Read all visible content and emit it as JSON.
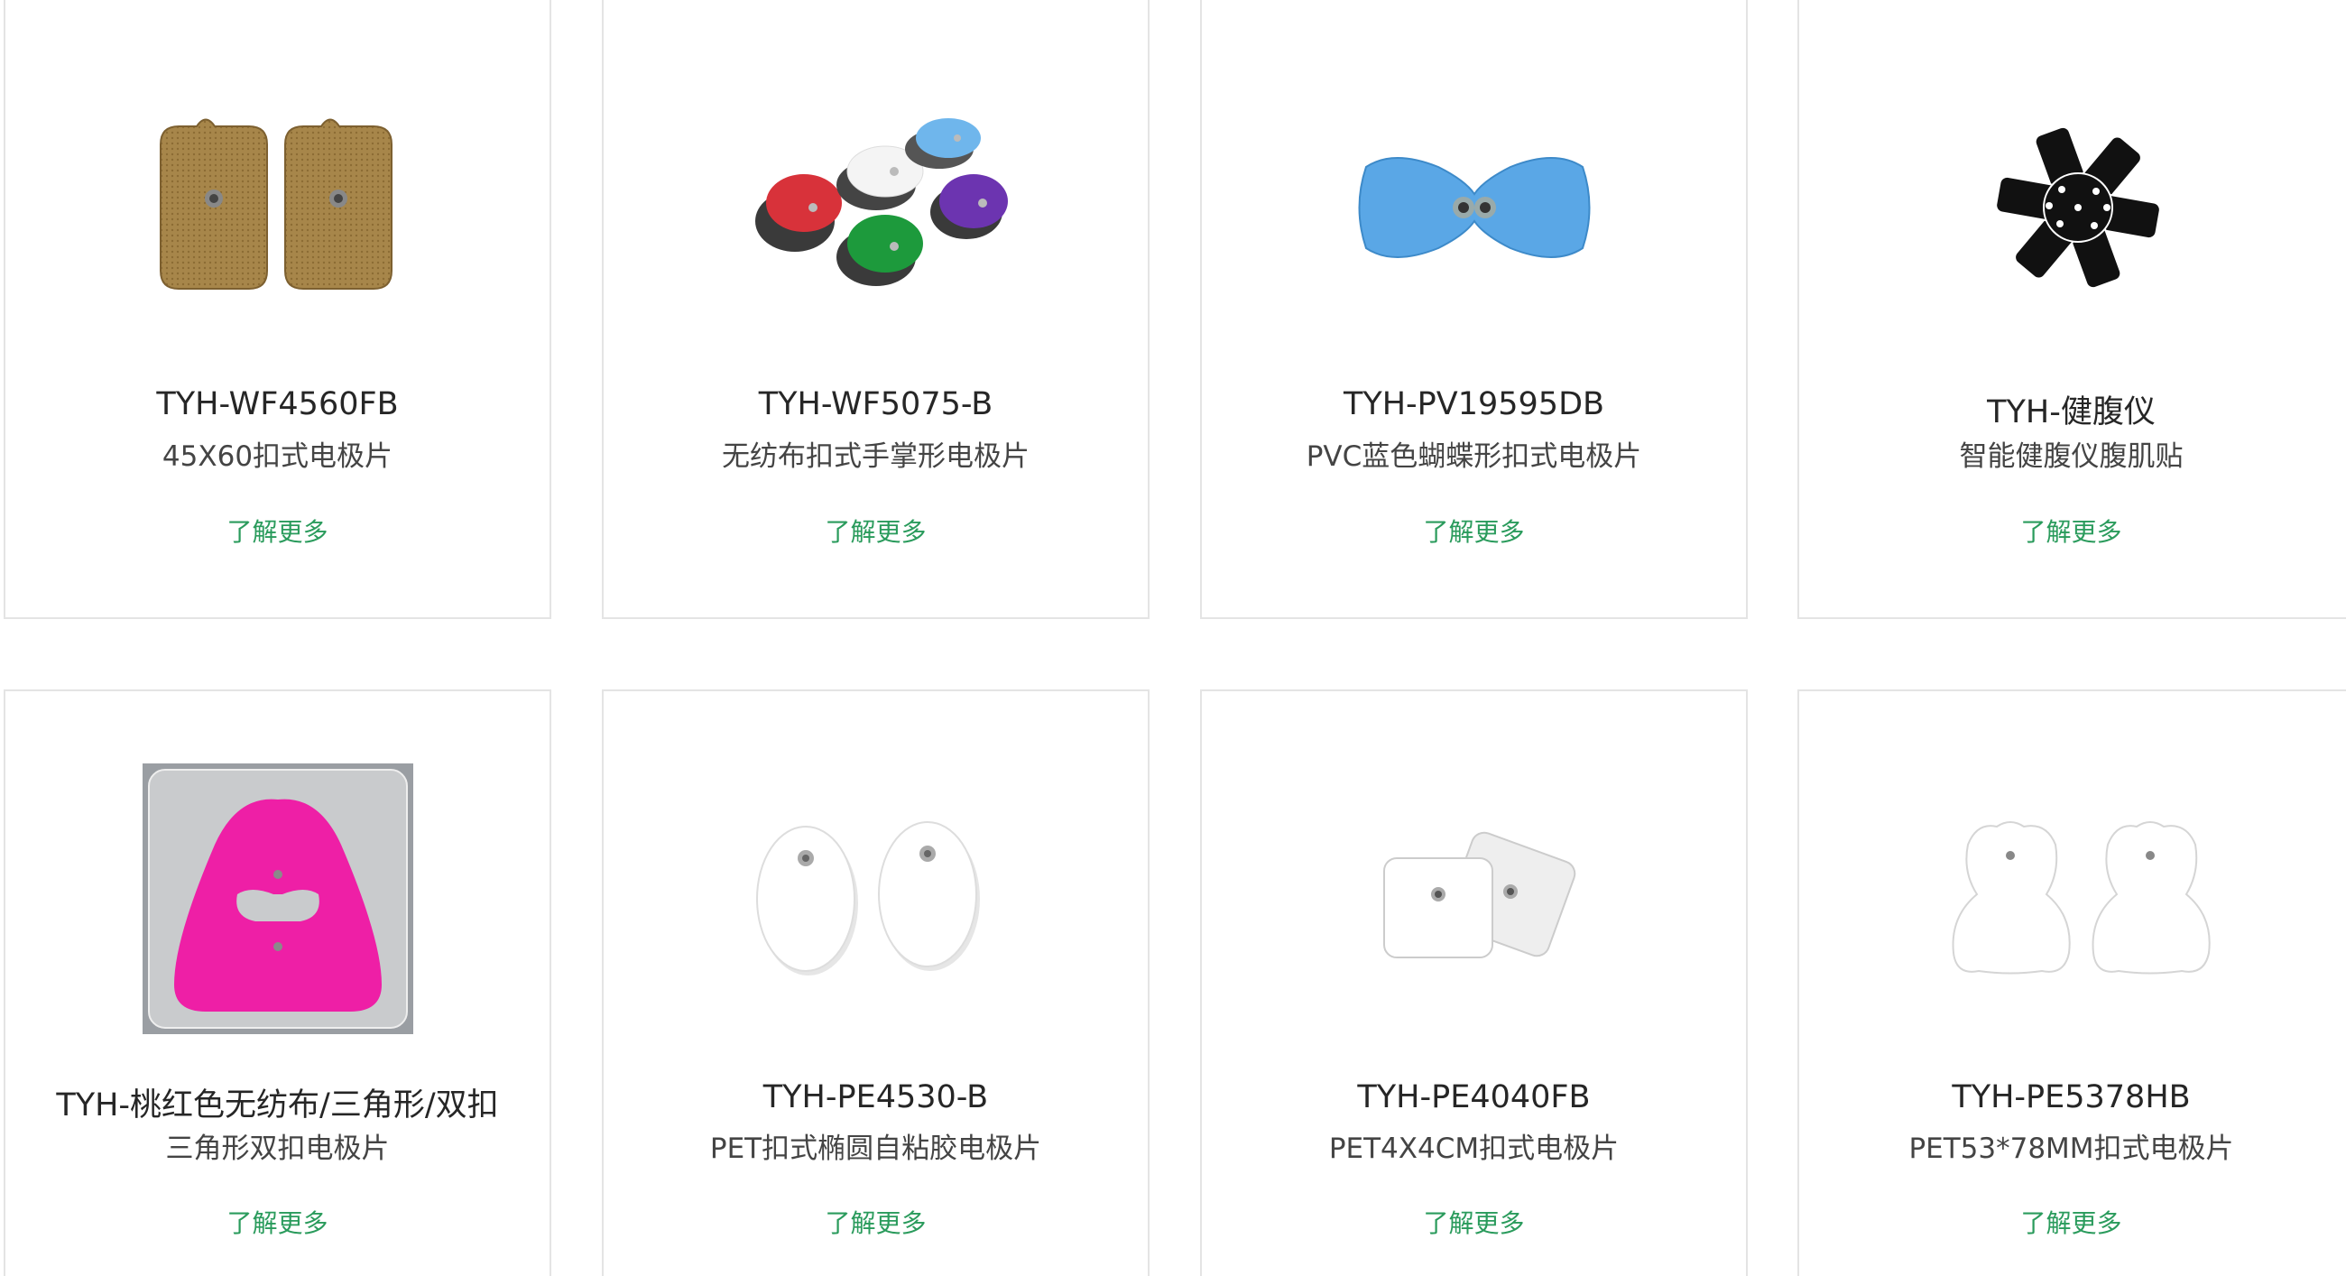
{
  "products": [
    {
      "name": "TYH-WF4560FB",
      "desc": "45X60扣式电极片",
      "link": "了解更多"
    },
    {
      "name": "TYH-WF5075-B",
      "desc": "无纺布扣式手掌形电极片",
      "link": "了解更多"
    },
    {
      "name": "TYH-PV19595DB",
      "desc": "PVC蓝色蝴蝶形扣式电极片",
      "link": "了解更多"
    },
    {
      "name": "TYH-健腹仪",
      "desc": "智能健腹仪腹肌贴",
      "link": "了解更多"
    },
    {
      "name": "TYH-桃红色无纺布/三角形/双扣",
      "desc": "三角形双扣电极片",
      "link": "了解更多"
    },
    {
      "name": "TYH-PE4530-B",
      "desc": "PET扣式椭圆自粘胶电极片",
      "link": "了解更多"
    },
    {
      "name": "TYH-PE4040FB",
      "desc": "PET4X4CM扣式电极片",
      "link": "了解更多"
    },
    {
      "name": "TYH-PE5378HB",
      "desc": "PET53*78MM扣式电极片",
      "link": "了解更多"
    }
  ],
  "colors": {
    "link": "#2a9b5c",
    "border": "#e4e4e4",
    "title": "#262626"
  }
}
